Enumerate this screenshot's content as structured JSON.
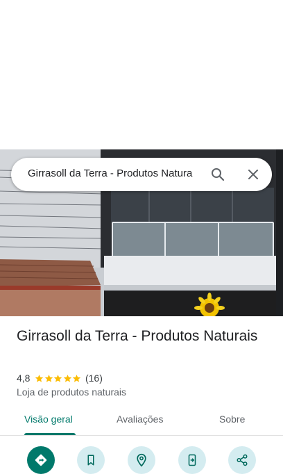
{
  "search": {
    "query": "Girrasoll da Terra - Produtos Natura",
    "icons": [
      "search-icon",
      "close-icon"
    ]
  },
  "place": {
    "name": "Girrasoll da Terra - Produtos Naturais",
    "rating": "4,8",
    "rating_value": 4.8,
    "stars_max": 5,
    "review_count": "(16)",
    "category": "Loja de produtos naturais"
  },
  "tabs": [
    {
      "label": "Visão geral",
      "active": true
    },
    {
      "label": "Avaliações",
      "active": false
    },
    {
      "label": "Sobre",
      "active": false
    }
  ],
  "actions": [
    "directions-icon",
    "bookmark-icon",
    "nearby-icon",
    "send-to-phone-icon",
    "share-icon"
  ],
  "colors": {
    "accent": "#00796b",
    "star": "#fbbc04",
    "action_bg": "#d4ecf0"
  }
}
